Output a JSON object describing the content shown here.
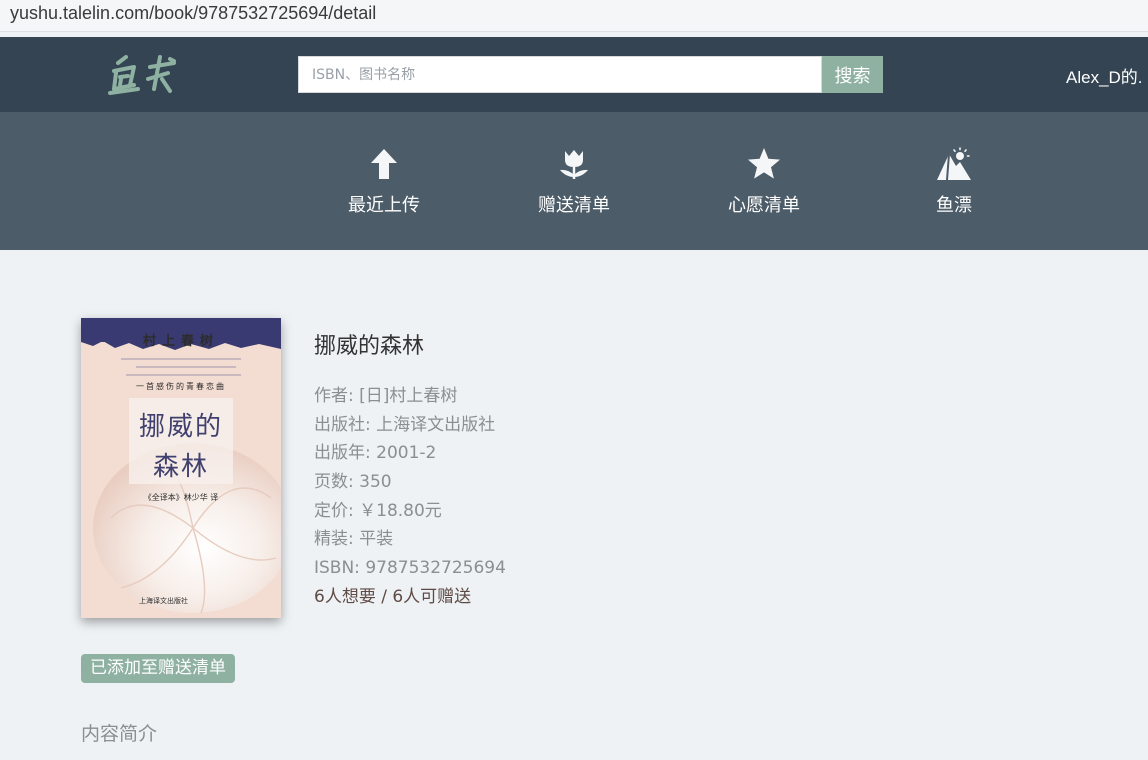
{
  "browser": {
    "url": "yushu.talelin.com/book/9787532725694/detail"
  },
  "header": {
    "logo_text": "鱼书",
    "search_placeholder": "ISBN、图书名称",
    "search_button": "搜索",
    "user_label": "Alex_D的."
  },
  "nav": {
    "items": [
      {
        "label": "最近上传",
        "icon": "arrow-up-icon"
      },
      {
        "label": "赠送清单",
        "icon": "flower-icon"
      },
      {
        "label": "心愿清单",
        "icon": "star-icon"
      },
      {
        "label": "鱼漂",
        "icon": "mountain-sun-icon"
      }
    ]
  },
  "book": {
    "cover": {
      "author": "村上春树",
      "tagline": "一首感伤的青春恋曲",
      "title_line1": "挪威的",
      "title_line2": "森林",
      "edition": "《全译本》林少华 译",
      "publisher": "上海译文出版社"
    },
    "title": "挪威的森林",
    "author": "作者: [日]村上春树",
    "publisher": "出版社: 上海译文出版社",
    "pubdate": "出版年:   2001-2",
    "pages": "页数:   350",
    "price": "定价:   ￥18.80元",
    "binding": "精装:   平装",
    "isbn": "ISBN:   9787532725694",
    "stats": "6人想要 / 6人可赠送"
  },
  "status_badge": "已添加至赠送清单",
  "summary_heading": "内容简介",
  "colors": {
    "header_bg": "#344452",
    "nav_bg": "#4d5c69",
    "accent": "#8eb1a2",
    "page_bg": "#eef2f5"
  }
}
